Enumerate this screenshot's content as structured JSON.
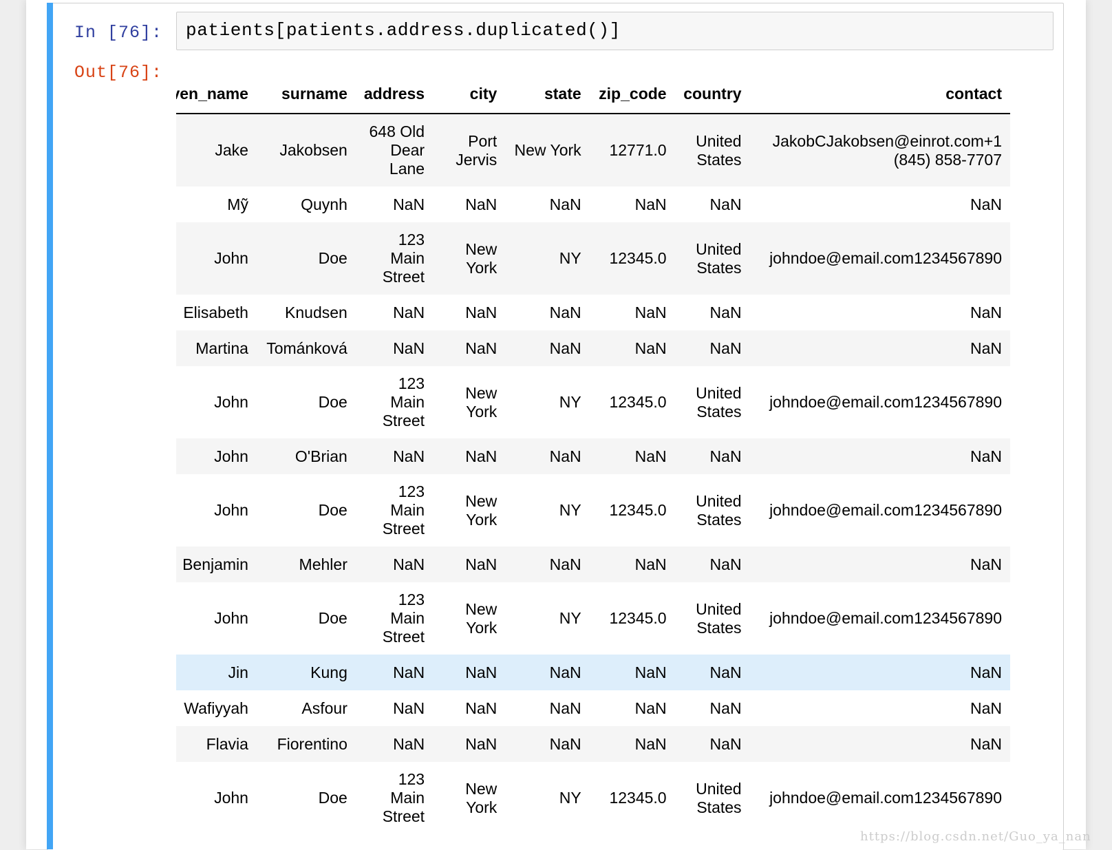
{
  "cell": {
    "in_prompt": "In [76]:",
    "out_prompt": "Out[76]:",
    "code": "patients[patients.address.duplicated()]"
  },
  "table": {
    "columns": [
      "given_name",
      "surname",
      "address",
      "city",
      "state",
      "zip_code",
      "country",
      "contact"
    ],
    "rows": [
      [
        "Jake",
        "Jakobsen",
        "648 Old Dear Lane",
        "Port Jervis",
        "New York",
        "12771.0",
        "United States",
        "JakobCJakobsen@einrot.com+1 (845) 858-7707"
      ],
      [
        "Mỹ",
        "Quynh",
        "NaN",
        "NaN",
        "NaN",
        "NaN",
        "NaN",
        "NaN"
      ],
      [
        "John",
        "Doe",
        "123 Main Street",
        "New York",
        "NY",
        "12345.0",
        "United States",
        "johndoe@email.com1234567890"
      ],
      [
        "Elisabeth",
        "Knudsen",
        "NaN",
        "NaN",
        "NaN",
        "NaN",
        "NaN",
        "NaN"
      ],
      [
        "Martina",
        "Tománková",
        "NaN",
        "NaN",
        "NaN",
        "NaN",
        "NaN",
        "NaN"
      ],
      [
        "John",
        "Doe",
        "123 Main Street",
        "New York",
        "NY",
        "12345.0",
        "United States",
        "johndoe@email.com1234567890"
      ],
      [
        "John",
        "O'Brian",
        "NaN",
        "NaN",
        "NaN",
        "NaN",
        "NaN",
        "NaN"
      ],
      [
        "John",
        "Doe",
        "123 Main Street",
        "New York",
        "NY",
        "12345.0",
        "United States",
        "johndoe@email.com1234567890"
      ],
      [
        "Benjamin",
        "Mehler",
        "NaN",
        "NaN",
        "NaN",
        "NaN",
        "NaN",
        "NaN"
      ],
      [
        "John",
        "Doe",
        "123 Main Street",
        "New York",
        "NY",
        "12345.0",
        "United States",
        "johndoe@email.com1234567890"
      ],
      [
        "Jin",
        "Kung",
        "NaN",
        "NaN",
        "NaN",
        "NaN",
        "NaN",
        "NaN"
      ],
      [
        "Wafiyyah",
        "Asfour",
        "NaN",
        "NaN",
        "NaN",
        "NaN",
        "NaN",
        "NaN"
      ],
      [
        "Flavia",
        "Fiorentino",
        "NaN",
        "NaN",
        "NaN",
        "NaN",
        "NaN",
        "NaN"
      ],
      [
        "John",
        "Doe",
        "123 Main Street",
        "New York",
        "NY",
        "12345.0",
        "United States",
        "johndoe@email.com1234567890"
      ]
    ],
    "hovered_row": 10
  },
  "watermark": "https://blog.csdn.net/Guo_ya_nan"
}
